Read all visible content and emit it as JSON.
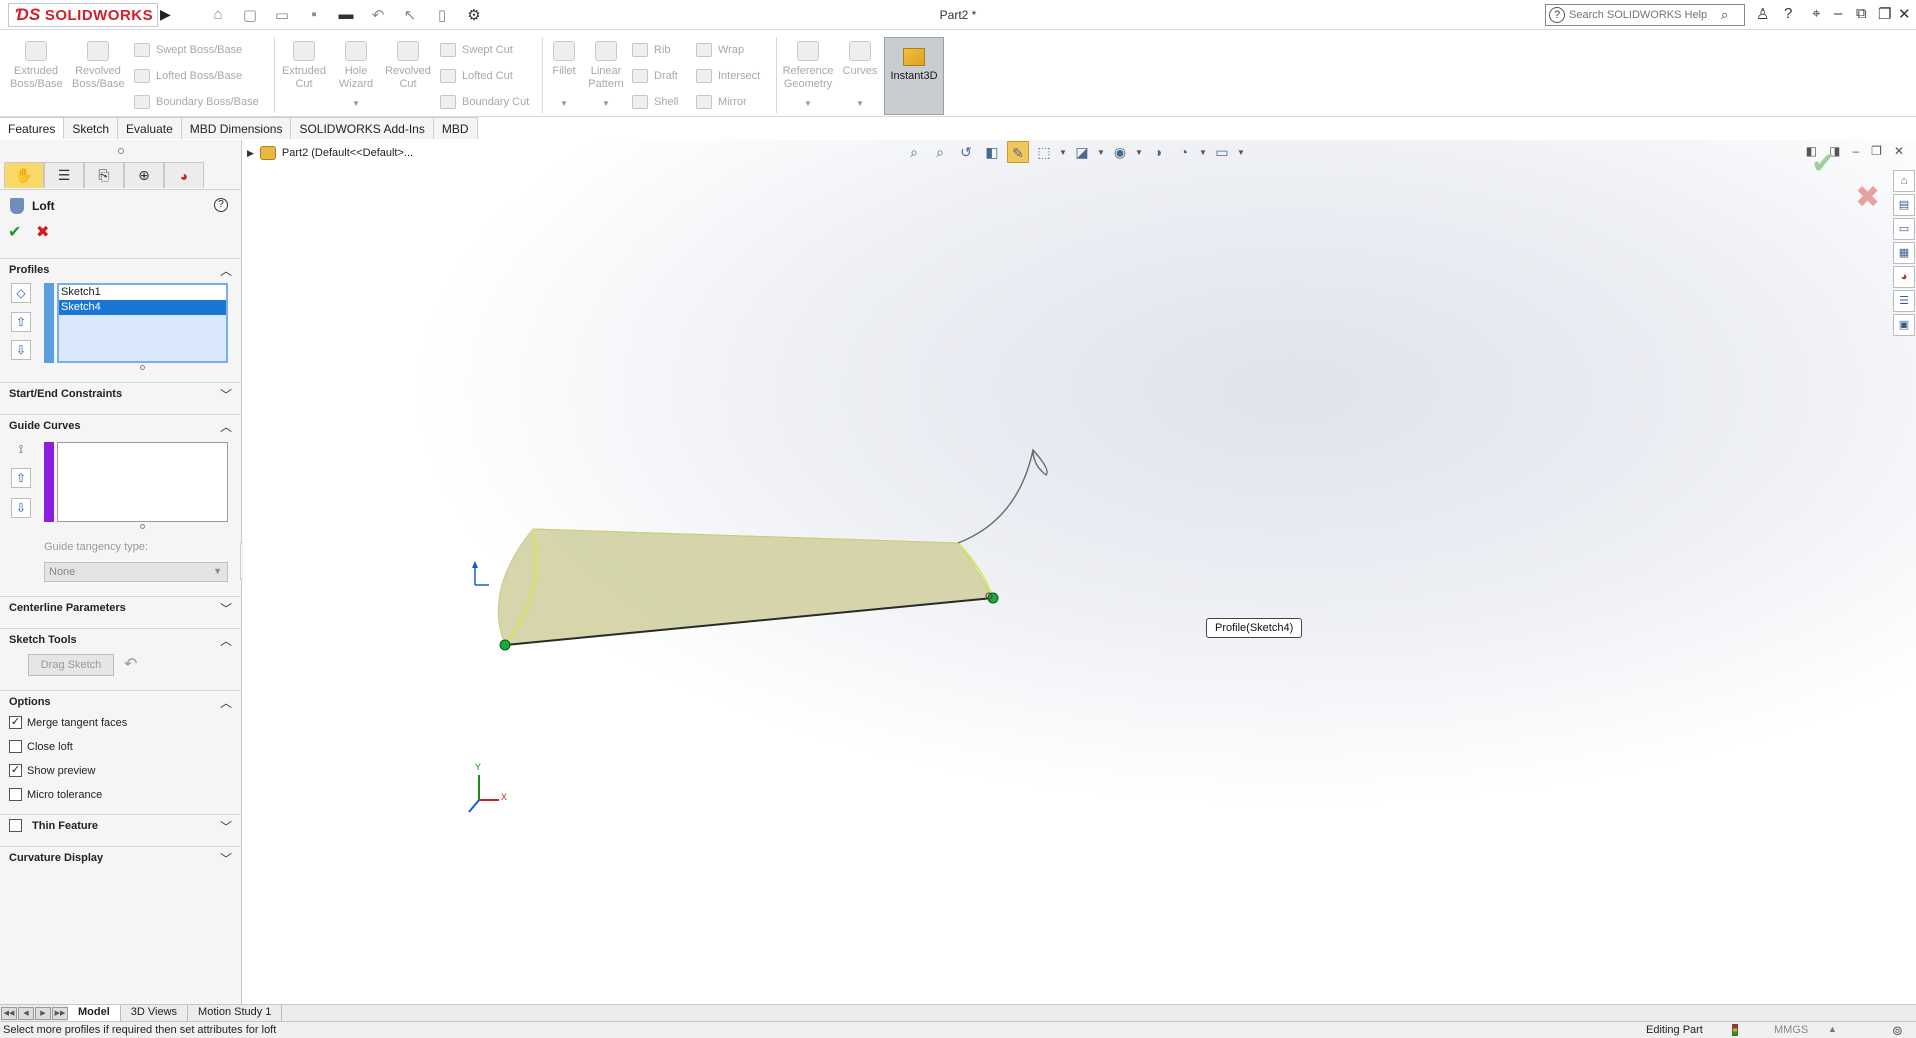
{
  "app": {
    "logo_text": "SOLIDWORKS",
    "doc_title": "Part2 *",
    "search_placeholder": "Search SOLIDWORKS Help"
  },
  "commands": {
    "extruded_boss": "Extruded Boss/Base",
    "revolved_boss": "Revolved Boss/Base",
    "swept_boss": "Swept Boss/Base",
    "lofted_boss": "Lofted Boss/Base",
    "boundary_boss": "Boundary Boss/Base",
    "extruded_cut": "Extruded Cut",
    "hole_wizard": "Hole Wizard",
    "revolved_cut": "Revolved Cut",
    "swept_cut": "Swept Cut",
    "lofted_cut": "Lofted Cut",
    "boundary_cut": "Boundary Cut",
    "fillet": "Fillet",
    "linear_pattern": "Linear Pattern",
    "rib": "Rib",
    "draft": "Draft",
    "shell": "Shell",
    "wrap": "Wrap",
    "intersect": "Intersect",
    "mirror": "Mirror",
    "reference_geometry": "Reference Geometry",
    "curves": "Curves",
    "instant3d": "Instant3D"
  },
  "cmd_tabs": [
    "Features",
    "Sketch",
    "Evaluate",
    "MBD Dimensions",
    "SOLIDWORKS Add-Ins",
    "MBD"
  ],
  "property_manager": {
    "title": "Loft",
    "profiles_header": "Profiles",
    "profiles": [
      "Sketch1",
      "Sketch4"
    ],
    "start_end_header": "Start/End Constraints",
    "guide_curves_header": "Guide Curves",
    "guide_tangency_label": "Guide tangency type:",
    "guide_tangency_value": "None",
    "centerline_header": "Centerline Parameters",
    "sketch_tools_header": "Sketch Tools",
    "drag_sketch_label": "Drag Sketch",
    "options_header": "Options",
    "options": [
      {
        "label": "Merge tangent faces",
        "checked": true
      },
      {
        "label": "Close loft",
        "checked": false
      },
      {
        "label": "Show preview",
        "checked": true
      },
      {
        "label": "Micro tolerance",
        "checked": false
      }
    ],
    "thin_feature_label": "Thin Feature",
    "curvature_display_header": "Curvature Display"
  },
  "viewport": {
    "tree_root": "Part2  (Default<<Default>...",
    "tooltip": "Profile(Sketch4)",
    "axis_x": "X",
    "axis_y": "Y"
  },
  "bottom_tabs": [
    "Model",
    "3D Views",
    "Motion Study 1"
  ],
  "status": {
    "message": "Select more profiles if required then set attributes for loft",
    "editing": "Editing Part",
    "units": "MMGS"
  }
}
